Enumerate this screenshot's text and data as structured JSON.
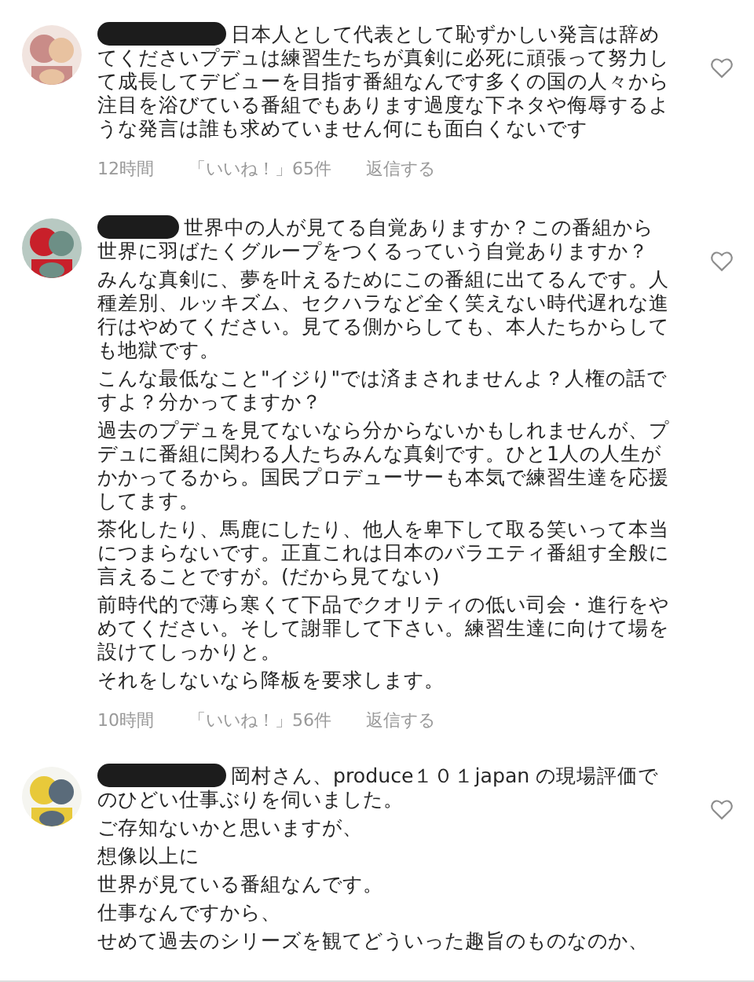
{
  "comments": [
    {
      "avatar": {
        "kind": "picture"
      },
      "username_redacted": true,
      "paragraphs": [
        "日本人として代表として恥ずかしい発言は辞めてくださいプデュは練習生たちが真剣に必死に頑張って努力して成長してデビューを目指す番組なんです多くの国の人々から注目を浴びている番組でもあります過度な下ネタや侮辱するような発言は誰も求めていません何にも面白くないです"
      ],
      "meta": {
        "time": "12時間",
        "likes": "「いいね！」65件",
        "reply": "返信する"
      }
    },
    {
      "avatar": {
        "kind": "picture"
      },
      "username_redacted": true,
      "paragraphs": [
        "世界中の人が見てる自覚ありますか？この番組から世界に羽ばたくグループをつくるっていう自覚ありますか？",
        "みんな真剣に、夢を叶えるためにこの番組に出てるんです。人種差別、ルッキズム、セクハラなど全く笑えない時代遅れな進行はやめてください。見てる側からしても、本人たちからしても地獄です。",
        "こんな最低なこと\"イジり\"では済まされませんよ？人権の話ですよ？分かってますか？",
        "過去のプデュを見てないなら分からないかもしれませんが、プデュに番組に関わる人たちみんな真剣です。ひと1人の人生がかかってるから。国民プロデューサーも本気で練習生達を応援してます。",
        "茶化したり、馬鹿にしたり、他人を卑下して取る笑いって本当につまらないです。正直これは日本のバラエティ番組す全般に言えることですが。(だから見てない)",
        "前時代的で薄ら寒くて下品でクオリティの低い司会・進行をやめてください。そして謝罪して下さい。練習生達に向けて場を設けてしっかりと。",
        "それをしないなら降板を要求します。"
      ],
      "meta": {
        "time": "10時間",
        "likes": "「いいね！」56件",
        "reply": "返信する"
      }
    },
    {
      "avatar": {
        "kind": "picture"
      },
      "username_redacted": true,
      "paragraphs": [
        "岡村さん、produce１０１japan の現場評価でのひどい仕事ぶりを伺いました。",
        "ご存知ないかと思いますが、",
        "想像以上に",
        "世界が見ている番組なんです。",
        "仕事なんですから、",
        "せめて過去のシリーズを観てどういった趣旨のものなのか、"
      ]
    }
  ]
}
